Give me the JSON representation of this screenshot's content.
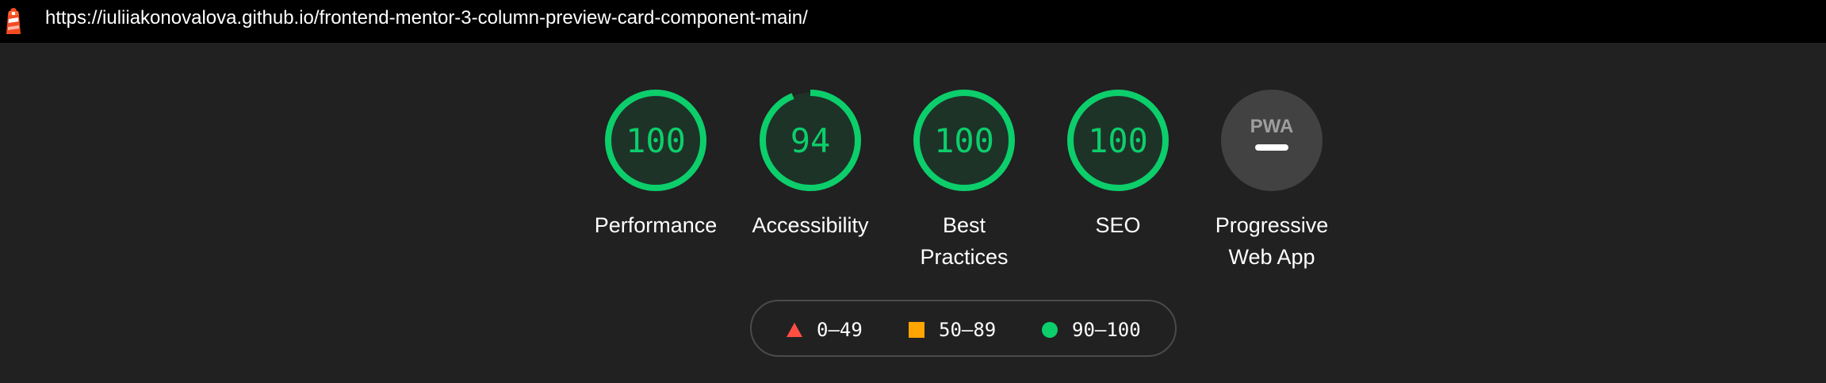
{
  "header": {
    "url": "https://iuliiakonovalova.github.io/frontend-mentor-3-column-preview-card-component-main/"
  },
  "categories": [
    {
      "label": "Performance",
      "score": "100",
      "value": 100
    },
    {
      "label": "Accessibility",
      "score": "94",
      "value": 94
    },
    {
      "label": "Best Practices",
      "score": "100",
      "value": 100
    },
    {
      "label": "SEO",
      "score": "100",
      "value": 100
    }
  ],
  "pwa": {
    "label": "Progressive Web App",
    "badge_text": "PWA"
  },
  "legend": [
    {
      "icon": "triangle-icon",
      "range": "0–49",
      "color": "#ff4e42"
    },
    {
      "icon": "square-icon",
      "range": "50–89",
      "color": "#ffa400"
    },
    {
      "icon": "circle-icon",
      "range": "90–100",
      "color": "#0cce6b"
    }
  ],
  "colors": {
    "pass": "#0cce6b",
    "background": "#212121",
    "header": "#000000"
  }
}
